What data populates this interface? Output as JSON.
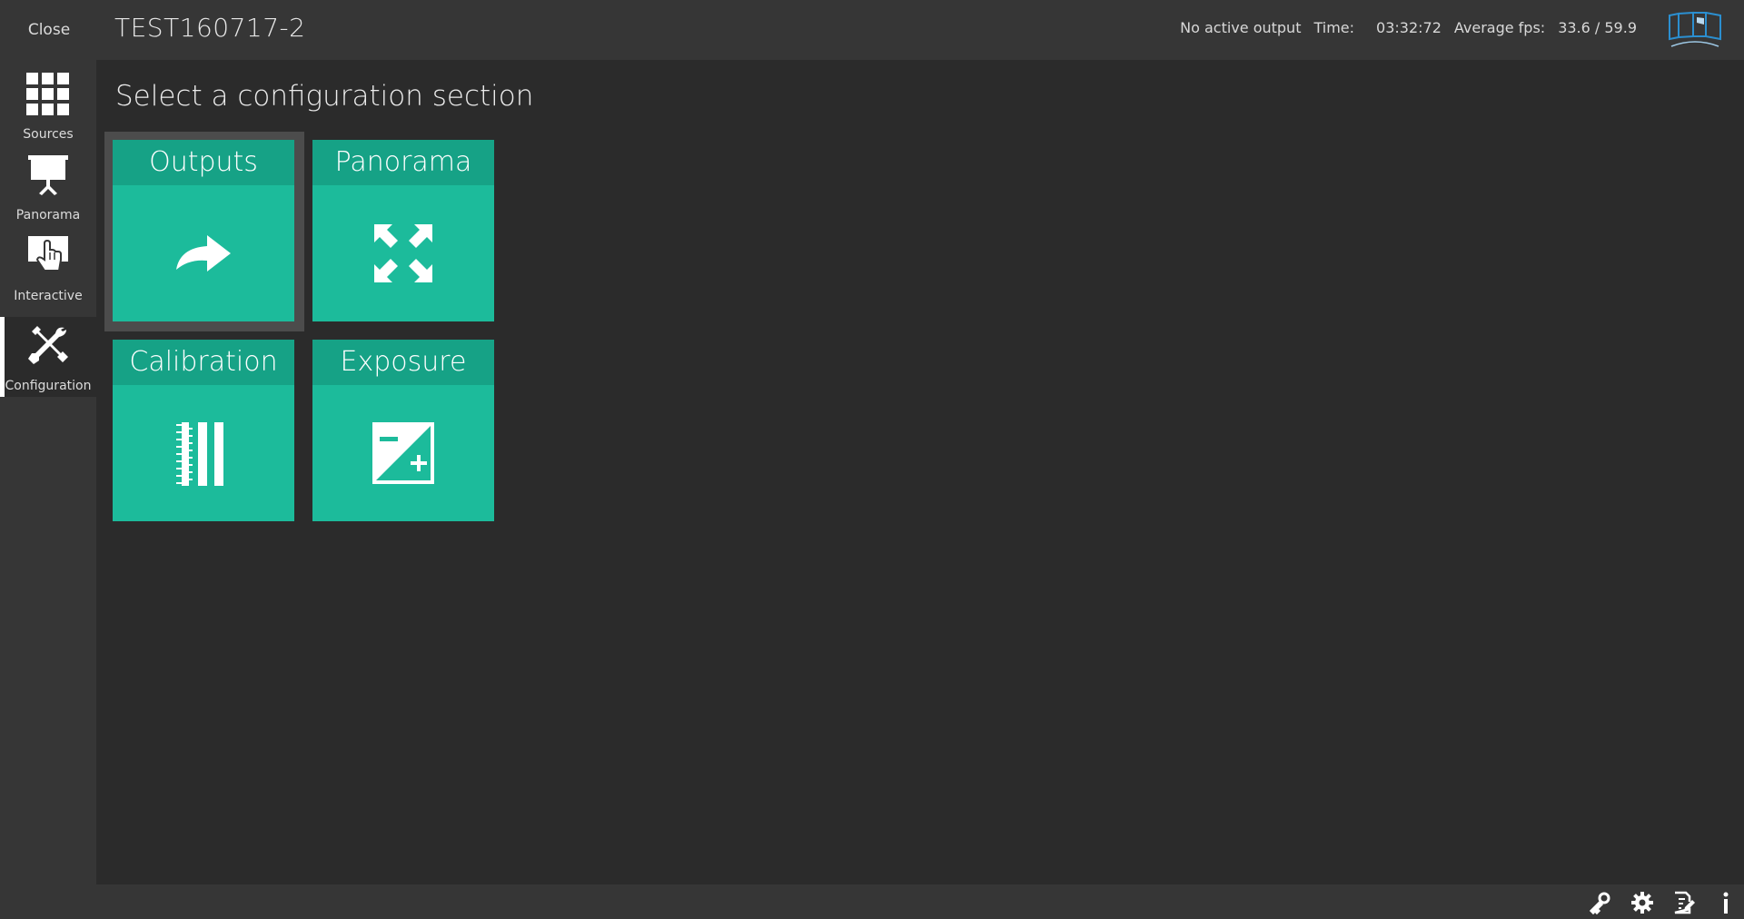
{
  "header": {
    "close_label": "Close",
    "project_title": "TEST160717-2",
    "output_status": "No active output",
    "time_label": "Time:",
    "time_value": "03:32:72",
    "fps_label": "Average fps:",
    "fps_value": "33.6 / 59.9",
    "logo_icon": "panorama-screen-logo"
  },
  "sidebar": {
    "items": [
      {
        "label": "Sources",
        "icon": "grid-icon",
        "active": false
      },
      {
        "label": "Panorama",
        "icon": "projector-screen-icon",
        "active": false
      },
      {
        "label": "Interactive",
        "icon": "touch-hand-icon",
        "active": false
      },
      {
        "label": "Configuration",
        "icon": "tools-icon",
        "active": true
      }
    ]
  },
  "main": {
    "title": "Select a configuration section",
    "tiles": [
      {
        "label": "Outputs",
        "icon": "share-arrow-icon",
        "selected": true
      },
      {
        "label": "Panorama",
        "icon": "expand-arrows-icon",
        "selected": false
      },
      {
        "label": "Calibration",
        "icon": "calibration-bars-icon",
        "selected": false
      },
      {
        "label": "Exposure",
        "icon": "exposure-icon",
        "selected": false
      }
    ]
  },
  "bottombar": {
    "icons": [
      "key-icon",
      "gear-icon",
      "edit-notes-icon",
      "info-icon"
    ]
  },
  "colors": {
    "accent": "#1cbb9b",
    "accent_dark": "#16a286",
    "background": "#2b2b2b",
    "panel": "#363636"
  }
}
